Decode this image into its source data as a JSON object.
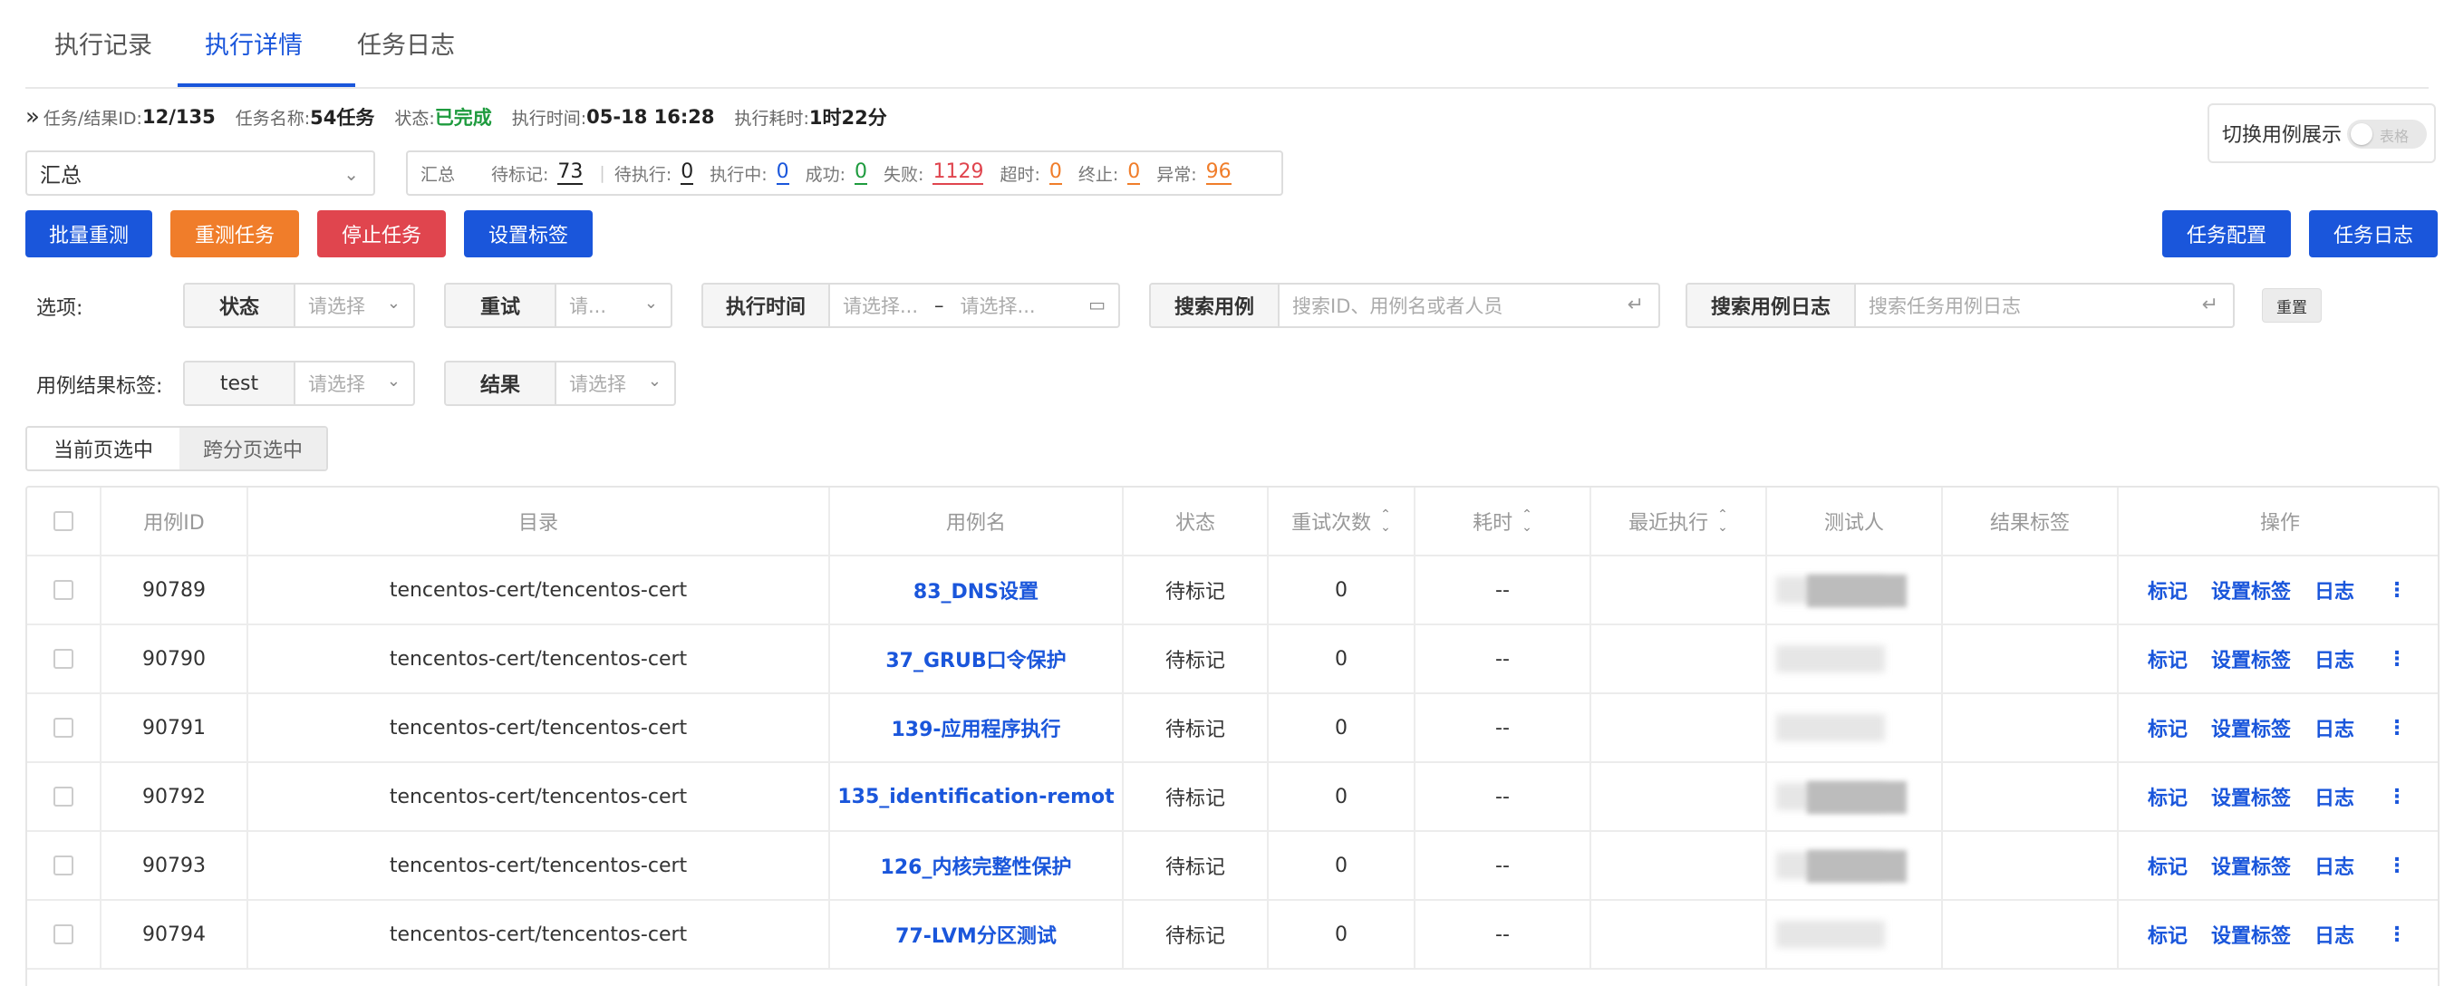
{
  "tabs": [
    "执行记录",
    "执行详情",
    "任务日志"
  ],
  "info": {
    "task_id_label": "任务/结果ID:",
    "task_id": "12/135",
    "task_name_label": "任务名称:",
    "task_name": "54任务",
    "status_label": "状态:",
    "status": "已完成",
    "exec_time_label": "执行时间:",
    "exec_time": "05-18 16:28",
    "duration_label": "执行耗时:",
    "duration": "1时22分"
  },
  "toggle": {
    "label": "切换用例展示",
    "switch_text": "表格"
  },
  "summary_select": "汇总",
  "stats": {
    "title": "汇总",
    "items": [
      {
        "label": "待标记:",
        "value": "73",
        "color": "#222222"
      },
      {
        "label": "待执行:",
        "value": "0",
        "color": "#222222"
      },
      {
        "label": "执行中:",
        "value": "0",
        "color": "#1a56db"
      },
      {
        "label": "成功:",
        "value": "0",
        "color": "#1e9b3e"
      },
      {
        "label": "失败:",
        "value": "1129",
        "color": "#e0454e"
      },
      {
        "label": "超时:",
        "value": "0",
        "color": "#f07d2a"
      },
      {
        "label": "终止:",
        "value": "0",
        "color": "#f07d2a"
      },
      {
        "label": "异常:",
        "value": "96",
        "color": "#f07d2a"
      }
    ]
  },
  "buttons": {
    "batch_retest": "批量重测",
    "retest_task": "重测任务",
    "stop_task": "停止任务",
    "set_tag": "设置标签",
    "task_config": "任务配置",
    "task_log": "任务日志"
  },
  "filters": {
    "options_label": "选项:",
    "status": {
      "name": "状态",
      "placeholder": "请选择"
    },
    "retry": {
      "name": "重试",
      "placeholder": "请..."
    },
    "exec_time": {
      "name": "执行时间",
      "start": "请选择...",
      "dash": "–",
      "end": "请选择..."
    },
    "search_case": {
      "name": "搜索用例",
      "placeholder": "搜索ID、用例名或者人员"
    },
    "search_log": {
      "name": "搜索用例日志",
      "placeholder": "搜索任务用例日志"
    },
    "reset": "重置",
    "result_tag_label": "用例结果标签:",
    "test": {
      "name": "test",
      "placeholder": "请选择"
    },
    "result": {
      "name": "结果",
      "placeholder": "请选择"
    }
  },
  "segment": {
    "current": "当前页选中",
    "cross": "跨分页选中"
  },
  "table": {
    "headers": [
      "用例ID",
      "目录",
      "用例名",
      "状态",
      "重试次数",
      "耗时",
      "最近执行",
      "测试人",
      "结果标签",
      "操作"
    ],
    "rows": [
      {
        "id": "90789",
        "dir": "tencentos-cert/tencentos-cert",
        "name": "83_DNS设置",
        "status": "待标记",
        "retries": "0",
        "time": "--"
      },
      {
        "id": "90790",
        "dir": "tencentos-cert/tencentos-cert",
        "name": "37_GRUB口令保护",
        "status": "待标记",
        "retries": "0",
        "time": "--"
      },
      {
        "id": "90791",
        "dir": "tencentos-cert/tencentos-cert",
        "name": "139-应用程序执行",
        "status": "待标记",
        "retries": "0",
        "time": "--"
      },
      {
        "id": "90792",
        "dir": "tencentos-cert/tencentos-cert",
        "name": "135_identification-remot",
        "status": "待标记",
        "retries": "0",
        "time": "--"
      },
      {
        "id": "90793",
        "dir": "tencentos-cert/tencentos-cert",
        "name": "126_内核完整性保护",
        "status": "待标记",
        "retries": "0",
        "time": "--"
      },
      {
        "id": "90794",
        "dir": "tencentos-cert/tencentos-cert",
        "name": "77-LVM分区测试",
        "status": "待标记",
        "retries": "0",
        "time": "--"
      }
    ],
    "ops": [
      "标记",
      "设置标签",
      "日志",
      "⋮"
    ]
  }
}
